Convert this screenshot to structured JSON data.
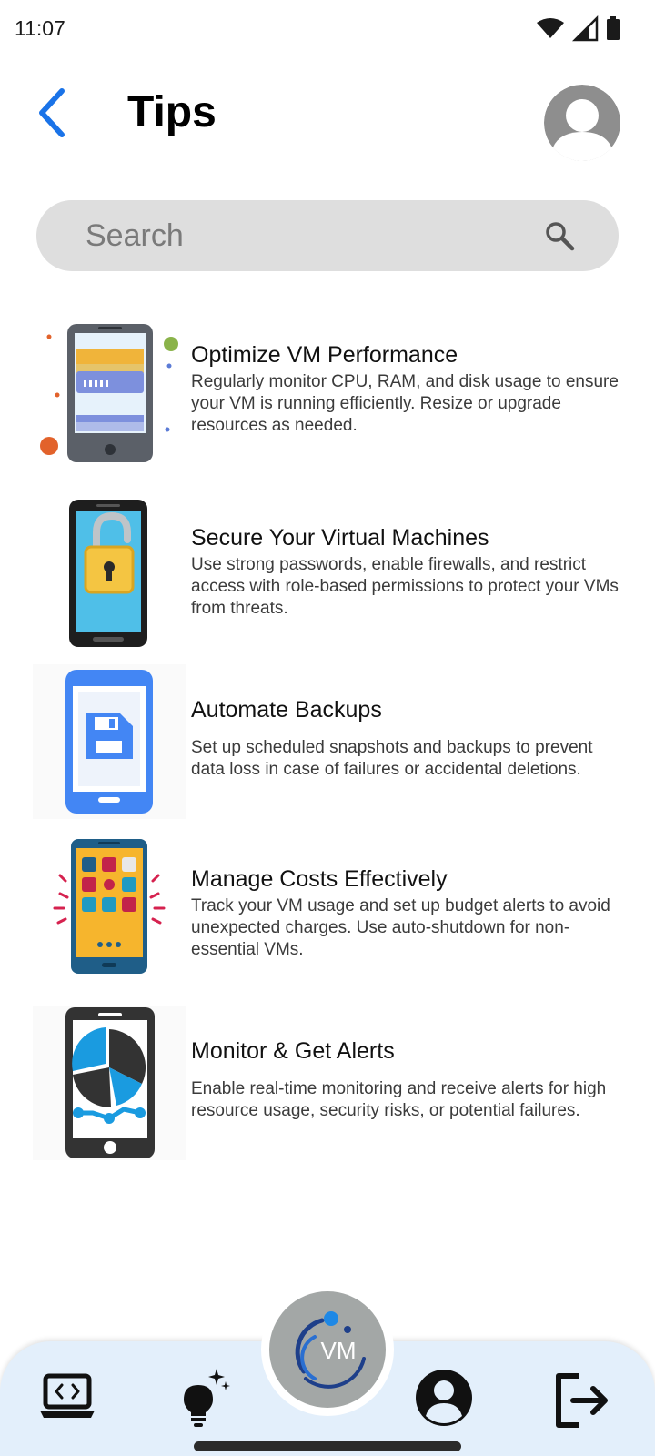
{
  "status_bar": {
    "time": "11:07"
  },
  "header": {
    "title": "Tips"
  },
  "search": {
    "placeholder": "Search"
  },
  "tips": [
    {
      "title": "Optimize VM Performance",
      "description": "Regularly monitor CPU, RAM, and disk usage to ensure your VM is running efficiently. Resize or upgrade resources as needed.",
      "icon": "phone-card-icon"
    },
    {
      "title": "Secure Your Virtual Machines",
      "description": "Use strong passwords, enable firewalls, and restrict access with role-based permissions to protect your VMs from threats.",
      "icon": "phone-padlock-icon"
    },
    {
      "title": "Automate Backups",
      "description": "Set up scheduled snapshots and backups to prevent data loss in case of failures or accidental deletions.",
      "icon": "phone-save-icon"
    },
    {
      "title": "Manage Costs Effectively",
      "description": "Track your VM usage and set up budget alerts to avoid unexpected charges. Use auto-shutdown for non-essential VMs.",
      "icon": "phone-apps-icon"
    },
    {
      "title": "Monitor & Get Alerts",
      "description": "Enable real-time monitoring and receive alerts for high resource usage, security risks, or potential failures.",
      "icon": "phone-chart-icon"
    }
  ],
  "fab": {
    "label": "VM"
  },
  "colors": {
    "accent": "#1a73e8",
    "nav_background": "#e3effb",
    "search_background": "#dedede"
  }
}
